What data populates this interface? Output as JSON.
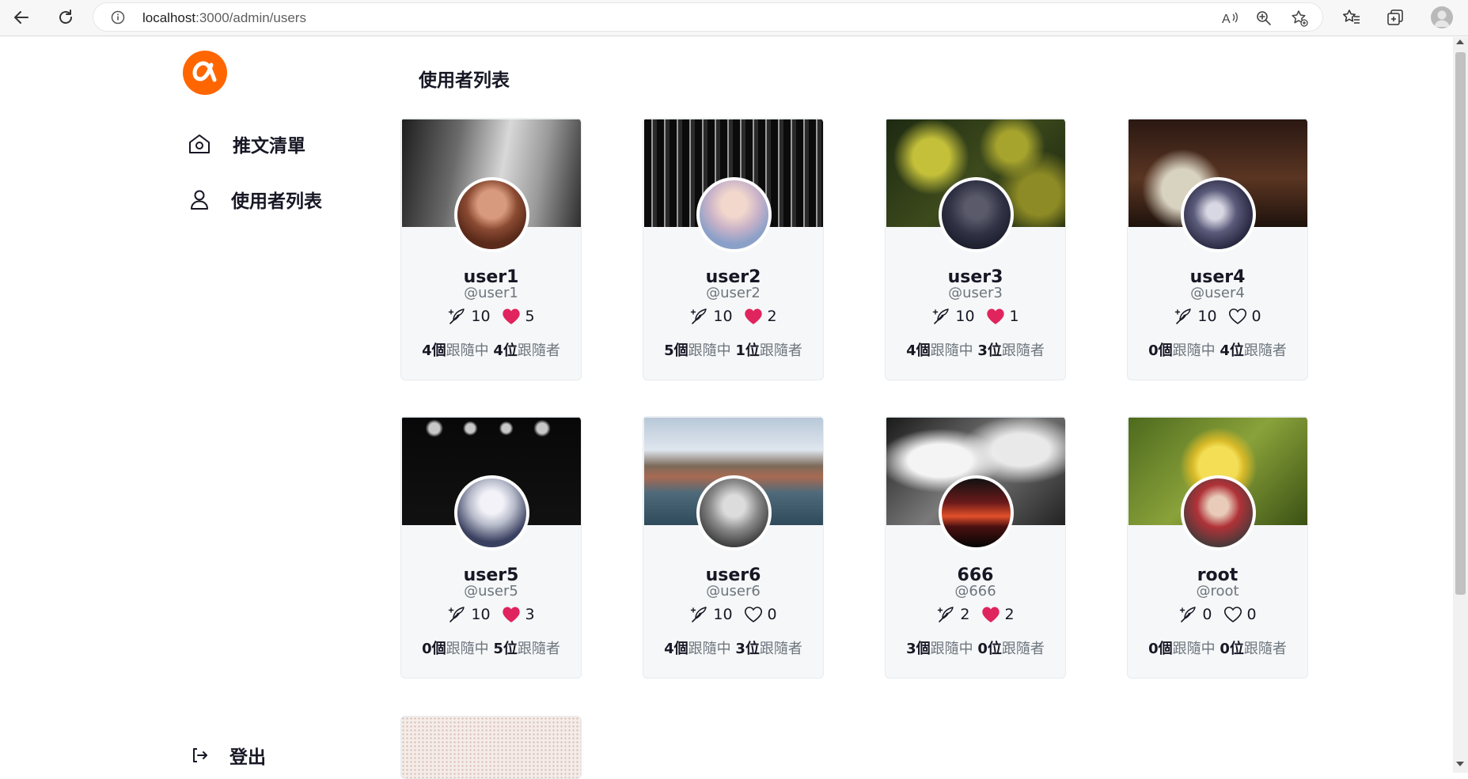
{
  "browser": {
    "url_host": "localhost",
    "url_path": ":3000/admin/users"
  },
  "sidebar": {
    "items": [
      {
        "label": "推文清單",
        "icon": "home-icon"
      },
      {
        "label": "使用者列表",
        "icon": "user-icon"
      }
    ],
    "logout_label": "登出"
  },
  "main": {
    "title": "使用者列表",
    "users": [
      {
        "name": "user1",
        "handle": "@user1",
        "tweets": "10",
        "likes": "5",
        "liked": true,
        "following": "4",
        "following_unit": "個",
        "following_label": "跟隨中",
        "followers": "4",
        "followers_unit": "位",
        "followers_label": "跟隨者"
      },
      {
        "name": "user2",
        "handle": "@user2",
        "tweets": "10",
        "likes": "2",
        "liked": true,
        "following": "5",
        "following_unit": "個",
        "following_label": "跟隨中",
        "followers": "1",
        "followers_unit": "位",
        "followers_label": "跟隨者"
      },
      {
        "name": "user3",
        "handle": "@user3",
        "tweets": "10",
        "likes": "1",
        "liked": true,
        "following": "4",
        "following_unit": "個",
        "following_label": "跟隨中",
        "followers": "3",
        "followers_unit": "位",
        "followers_label": "跟隨者"
      },
      {
        "name": "user4",
        "handle": "@user4",
        "tweets": "10",
        "likes": "0",
        "liked": false,
        "following": "0",
        "following_unit": "個",
        "following_label": "跟隨中",
        "followers": "4",
        "followers_unit": "位",
        "followers_label": "跟隨者"
      },
      {
        "name": "user5",
        "handle": "@user5",
        "tweets": "10",
        "likes": "3",
        "liked": true,
        "following": "0",
        "following_unit": "個",
        "following_label": "跟隨中",
        "followers": "5",
        "followers_unit": "位",
        "followers_label": "跟隨者"
      },
      {
        "name": "user6",
        "handle": "@user6",
        "tweets": "10",
        "likes": "0",
        "liked": false,
        "following": "4",
        "following_unit": "個",
        "following_label": "跟隨中",
        "followers": "3",
        "followers_unit": "位",
        "followers_label": "跟隨者"
      },
      {
        "name": "666",
        "handle": "@666",
        "tweets": "2",
        "likes": "2",
        "liked": true,
        "following": "3",
        "following_unit": "個",
        "following_label": "跟隨中",
        "followers": "0",
        "followers_unit": "位",
        "followers_label": "跟隨者"
      },
      {
        "name": "root",
        "handle": "@root",
        "tweets": "0",
        "likes": "0",
        "liked": false,
        "following": "0",
        "following_unit": "個",
        "following_label": "跟隨中",
        "followers": "0",
        "followers_unit": "位",
        "followers_label": "跟隨者"
      }
    ]
  },
  "colors": {
    "brand": "#ff6600",
    "heart": "#e0245e",
    "text_dark": "#171725",
    "text_muted": "#6c757d",
    "card_bg": "#f6f7f8"
  }
}
